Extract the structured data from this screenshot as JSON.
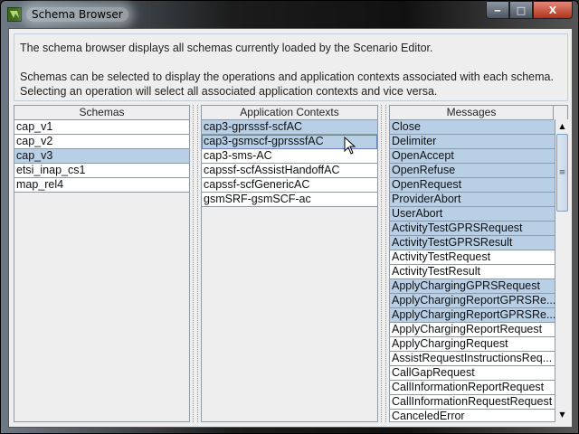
{
  "window": {
    "title": "Schema Browser",
    "minimize": "‒",
    "maximize": "□",
    "close": "X"
  },
  "info": {
    "line1": "The schema browser displays all schemas currently loaded by the Scenario Editor.",
    "line2": "Schemas can be selected to display the operations and application contexts associated with each schema.",
    "line3": "Selecting an operation will select all associated application contexts and vice versa."
  },
  "schemas": {
    "header": "Schemas",
    "items": [
      {
        "label": "cap_v1",
        "selected": false
      },
      {
        "label": "cap_v2",
        "selected": false
      },
      {
        "label": "cap_v3",
        "selected": true
      },
      {
        "label": "etsi_inap_cs1",
        "selected": false
      },
      {
        "label": "map_rel4",
        "selected": false
      }
    ]
  },
  "contexts": {
    "header": "Application Contexts",
    "items": [
      {
        "label": "cap3-gprsssf-scfAC",
        "selected": true
      },
      {
        "label": "cap3-gsmscf-gprsssfAC",
        "selected": true,
        "focused": true
      },
      {
        "label": "cap3-sms-AC",
        "selected": false
      },
      {
        "label": "capssf-scfAssistHandoffAC",
        "selected": false
      },
      {
        "label": "capssf-scfGenericAC",
        "selected": false
      },
      {
        "label": "gsmSRF-gsmSCF-ac",
        "selected": false
      }
    ]
  },
  "messages": {
    "header": "Messages",
    "items": [
      {
        "label": "Close",
        "selected": true
      },
      {
        "label": "Delimiter",
        "selected": true
      },
      {
        "label": "OpenAccept",
        "selected": true
      },
      {
        "label": "OpenRefuse",
        "selected": true
      },
      {
        "label": "OpenRequest",
        "selected": true
      },
      {
        "label": "ProviderAbort",
        "selected": true
      },
      {
        "label": "UserAbort",
        "selected": true
      },
      {
        "label": "ActivityTestGPRSRequest",
        "selected": true
      },
      {
        "label": "ActivityTestGPRSResult",
        "selected": true
      },
      {
        "label": "ActivityTestRequest",
        "selected": false
      },
      {
        "label": "ActivityTestResult",
        "selected": false
      },
      {
        "label": "ApplyChargingGPRSRequest",
        "selected": true
      },
      {
        "label": "ApplyChargingReportGPRSRe...",
        "selected": true
      },
      {
        "label": "ApplyChargingReportGPRSRe...",
        "selected": true
      },
      {
        "label": "ApplyChargingReportRequest",
        "selected": false
      },
      {
        "label": "ApplyChargingRequest",
        "selected": false
      },
      {
        "label": "AssistRequestInstructionsReq...",
        "selected": false
      },
      {
        "label": "CallGapRequest",
        "selected": false
      },
      {
        "label": "CallInformationReportRequest",
        "selected": false
      },
      {
        "label": "CallInformationRequestRequest",
        "selected": false
      },
      {
        "label": "CanceledError",
        "selected": false
      }
    ]
  },
  "scrollbar": {
    "position_fraction": 0.0,
    "visible_fraction": 0.3
  },
  "colors": {
    "selection": "#b8cfe5",
    "border": "#8c99a8"
  }
}
